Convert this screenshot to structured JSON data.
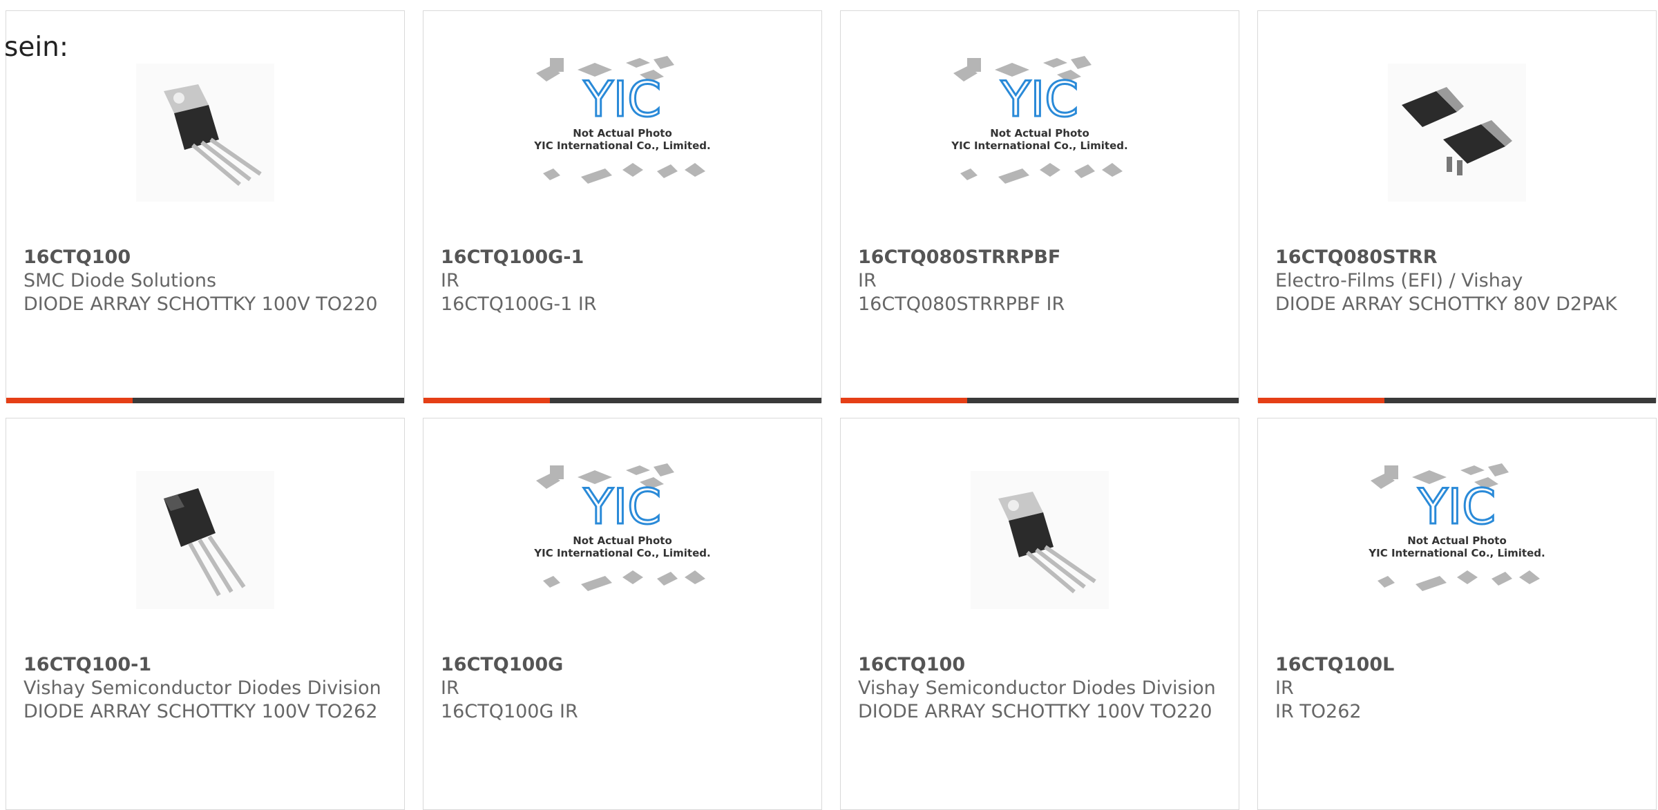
{
  "lead_text": "sein:",
  "colors": {
    "accent": "#e53f16",
    "bar": "#3a3a3a",
    "border": "#d9d9d9",
    "yic_blue": "#2a8ad8"
  },
  "placeholder": {
    "logo": "YIC",
    "line1": "Not Actual Photo",
    "line2": "YIC International Co., Limited."
  },
  "products": [
    {
      "part": "16CTQ100",
      "maker": "SMC Diode Solutions",
      "desc": "DIODE ARRAY SCHOTTKY 100V TO220",
      "image": "to220-icon"
    },
    {
      "part": "16CTQ100G-1",
      "maker": "IR",
      "desc": "16CTQ100G-1 IR",
      "image": "yic-placeholder-icon"
    },
    {
      "part": "16CTQ080STRRPBF",
      "maker": "IR",
      "desc": "16CTQ080STRRPBF IR",
      "image": "yic-placeholder-icon"
    },
    {
      "part": "16CTQ080STRR",
      "maker": "Electro-Films (EFI) / Vishay",
      "desc": "DIODE ARRAY SCHOTTKY 80V D2PAK",
      "image": "d2pak-icon"
    },
    {
      "part": "16CTQ100-1",
      "maker": "Vishay Semiconductor Diodes Division",
      "desc": "DIODE ARRAY SCHOTTKY 100V TO262",
      "image": "to262-icon"
    },
    {
      "part": "16CTQ100G",
      "maker": "IR",
      "desc": "16CTQ100G IR",
      "image": "yic-placeholder-icon"
    },
    {
      "part": "16CTQ100",
      "maker": "Vishay Semiconductor Diodes Division",
      "desc": "DIODE ARRAY SCHOTTKY 100V TO220",
      "image": "to220-icon"
    },
    {
      "part": "16CTQ100L",
      "maker": "IR",
      "desc": "IR TO262",
      "image": "yic-placeholder-icon"
    }
  ]
}
